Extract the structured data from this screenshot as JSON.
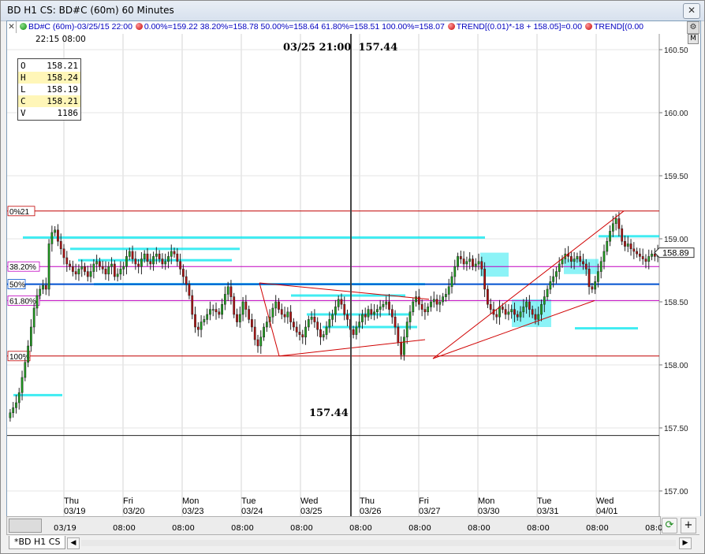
{
  "window": {
    "title": "BD H1 CS: BD#C (60m) 60 Minutes",
    "close_glyph": "✕"
  },
  "study_bar": {
    "close_glyph": "✕",
    "symbol": "BD#C (60m)-03/25/15 22:00",
    "fib": "0.00%=159.22 38.20%=158.78 50.00%=158.64 61.80%=158.51 100.00%=158.07",
    "trend1": "TREND[(0.01)*-18 + 158.05]=0.00",
    "trend2": "TREND[(0.00",
    "gear_glyph": "⚙"
  },
  "header": {
    "time_left": "22:15  08:00",
    "m_button": "M"
  },
  "ohlc": [
    {
      "k": "O",
      "v": "158.21",
      "hl": false
    },
    {
      "k": "H",
      "v": "158.24",
      "hl": true
    },
    {
      "k": "L",
      "v": "158.19",
      "hl": false
    },
    {
      "k": "C",
      "v": "158.21",
      "hl": true
    },
    {
      "k": "V",
      "v": "1186",
      "hl": false
    }
  ],
  "cursor": {
    "time_label": "03/25 21:00",
    "price_label": "157.44",
    "price_bottom": "157.44",
    "price": 157.44
  },
  "fib_labels": [
    {
      "label": "0%",
      "value": "21",
      "price": 159.22,
      "color": "#c00000"
    },
    {
      "label": "38.20%",
      "value": "",
      "price": 158.78,
      "color": "#c000c0"
    },
    {
      "label": "50%",
      "value": "",
      "price": 158.64,
      "color": "#0050d0"
    },
    {
      "label": "61.80%",
      "value": "",
      "price": 158.51,
      "color": "#c000c0"
    },
    {
      "label": "100%",
      "value": "",
      "price": 158.07,
      "color": "#c00000"
    }
  ],
  "last_price": {
    "label": "158.89",
    "price": 158.89
  },
  "y_axis": {
    "min": 156.8,
    "max": 160.6,
    "ticks": [
      "160.50",
      "160.00",
      "159.50",
      "159.00",
      "158.50",
      "158.00",
      "157.50",
      "157.00"
    ]
  },
  "days": [
    {
      "dow": "Thu",
      "date": "03/19"
    },
    {
      "dow": "Fri",
      "date": "03/20"
    },
    {
      "dow": "Mon",
      "date": "03/23"
    },
    {
      "dow": "Tue",
      "date": "03/24"
    },
    {
      "dow": "Wed",
      "date": "03/25"
    },
    {
      "dow": "Thu",
      "date": "03/26"
    },
    {
      "dow": "Fri",
      "date": "03/27"
    },
    {
      "dow": "Mon",
      "date": "03/30"
    },
    {
      "dow": "Tue",
      "date": "03/31"
    },
    {
      "dow": "Wed",
      "date": "04/01"
    }
  ],
  "x_axis": [
    "03/19",
    "08:00",
    "08:00",
    "08:00",
    "08:00",
    "08:00",
    "08:00",
    "08:00",
    "08:00",
    "08:00",
    "08:00"
  ],
  "bottom": {
    "refresh_glyph": "⟳",
    "plus_glyph": "+",
    "tab_label": "*BD H1 CS",
    "left_arrow": "◀",
    "right_arrow": "▶"
  },
  "colors": {
    "bull": "#1e9e1e",
    "bear": "#b01010",
    "zone": "#00e5ee",
    "trend": "#d00000"
  },
  "chart_data": {
    "type": "candlestick",
    "title": "BD H1 CS: BD#C (60m) 60 Minutes",
    "ylim": [
      156.8,
      160.6
    ],
    "fib_levels": {
      "0%": 159.22,
      "38.20%": 158.78,
      "50%": 158.64,
      "61.80%": 158.51,
      "100%": 158.07
    },
    "close_sequence": [
      157.62,
      157.66,
      157.7,
      157.78,
      157.9,
      158.02,
      158.15,
      158.3,
      158.45,
      158.55,
      158.6,
      158.63,
      158.6,
      158.96,
      159.05,
      159.07,
      158.98,
      158.92,
      158.85,
      158.8,
      158.78,
      158.74,
      158.72,
      158.76,
      158.78,
      158.74,
      158.7,
      158.74,
      158.8,
      158.82,
      158.78,
      158.76,
      158.72,
      158.78,
      158.8,
      158.7,
      158.72,
      158.76,
      158.78,
      158.86,
      158.9,
      158.84,
      158.8,
      158.78,
      158.84,
      158.88,
      158.82,
      158.8,
      158.86,
      158.88,
      158.84,
      158.8,
      158.82,
      158.86,
      158.9,
      158.88,
      158.82,
      158.76,
      158.7,
      158.64,
      158.55,
      158.4,
      158.3,
      158.28,
      158.34,
      158.36,
      158.4,
      158.44,
      158.44,
      158.42,
      158.4,
      158.48,
      158.56,
      158.62,
      158.54,
      158.4,
      158.34,
      158.4,
      158.5,
      158.44,
      158.36,
      158.3,
      158.2,
      158.15,
      158.22,
      158.3,
      158.34,
      158.38,
      158.45,
      158.5,
      158.44,
      158.4,
      158.38,
      158.42,
      158.34,
      158.3,
      158.26,
      158.24,
      158.22,
      158.3,
      158.36,
      158.38,
      158.34,
      158.28,
      158.22,
      158.24,
      158.3,
      158.36,
      158.4,
      158.46,
      158.52,
      158.48,
      158.4,
      158.36,
      158.28,
      158.24,
      158.3,
      158.34,
      158.4,
      158.38,
      158.44,
      158.4,
      158.42,
      158.44,
      158.46,
      158.48,
      158.5,
      158.44,
      158.38,
      158.3,
      158.18,
      158.08,
      158.22,
      158.34,
      158.42,
      158.5,
      158.54,
      158.48,
      158.44,
      158.42,
      158.46,
      158.5,
      158.52,
      158.48,
      158.5,
      158.54,
      158.56,
      158.62,
      158.7,
      158.78,
      158.86,
      158.84,
      158.8,
      158.82,
      158.84,
      158.78,
      158.8,
      158.82,
      158.76,
      158.6,
      158.48,
      158.44,
      158.4,
      158.38,
      158.46,
      158.44,
      158.4,
      158.42,
      158.44,
      158.4,
      158.38,
      158.42,
      158.46,
      158.5,
      158.44,
      158.4,
      158.36,
      158.4,
      158.48,
      158.54,
      158.6,
      158.66,
      158.7,
      158.74,
      158.8,
      158.84,
      158.88,
      158.86,
      158.82,
      158.84,
      158.86,
      158.82,
      158.8,
      158.76,
      158.62,
      158.6,
      158.66,
      158.74,
      158.82,
      158.9,
      158.98,
      159.06,
      159.12,
      159.16,
      159.08,
      158.98,
      158.94,
      158.96,
      158.92,
      158.9,
      158.88,
      158.86,
      158.84,
      158.82,
      158.86,
      158.88,
      158.86,
      158.89
    ],
    "trend_lines": [
      {
        "from": [
          "03/24",
          158.65
        ],
        "to": [
          "03/26",
          158.52
        ]
      },
      {
        "from": [
          "03/24",
          158.07
        ],
        "to": [
          "03/26",
          158.2
        ]
      },
      {
        "from": [
          "03/27",
          158.05
        ],
        "to": [
          "04/01",
          159.22
        ]
      },
      {
        "from": [
          "03/27",
          158.05
        ],
        "to": [
          "04/01",
          158.51
        ]
      }
    ]
  }
}
